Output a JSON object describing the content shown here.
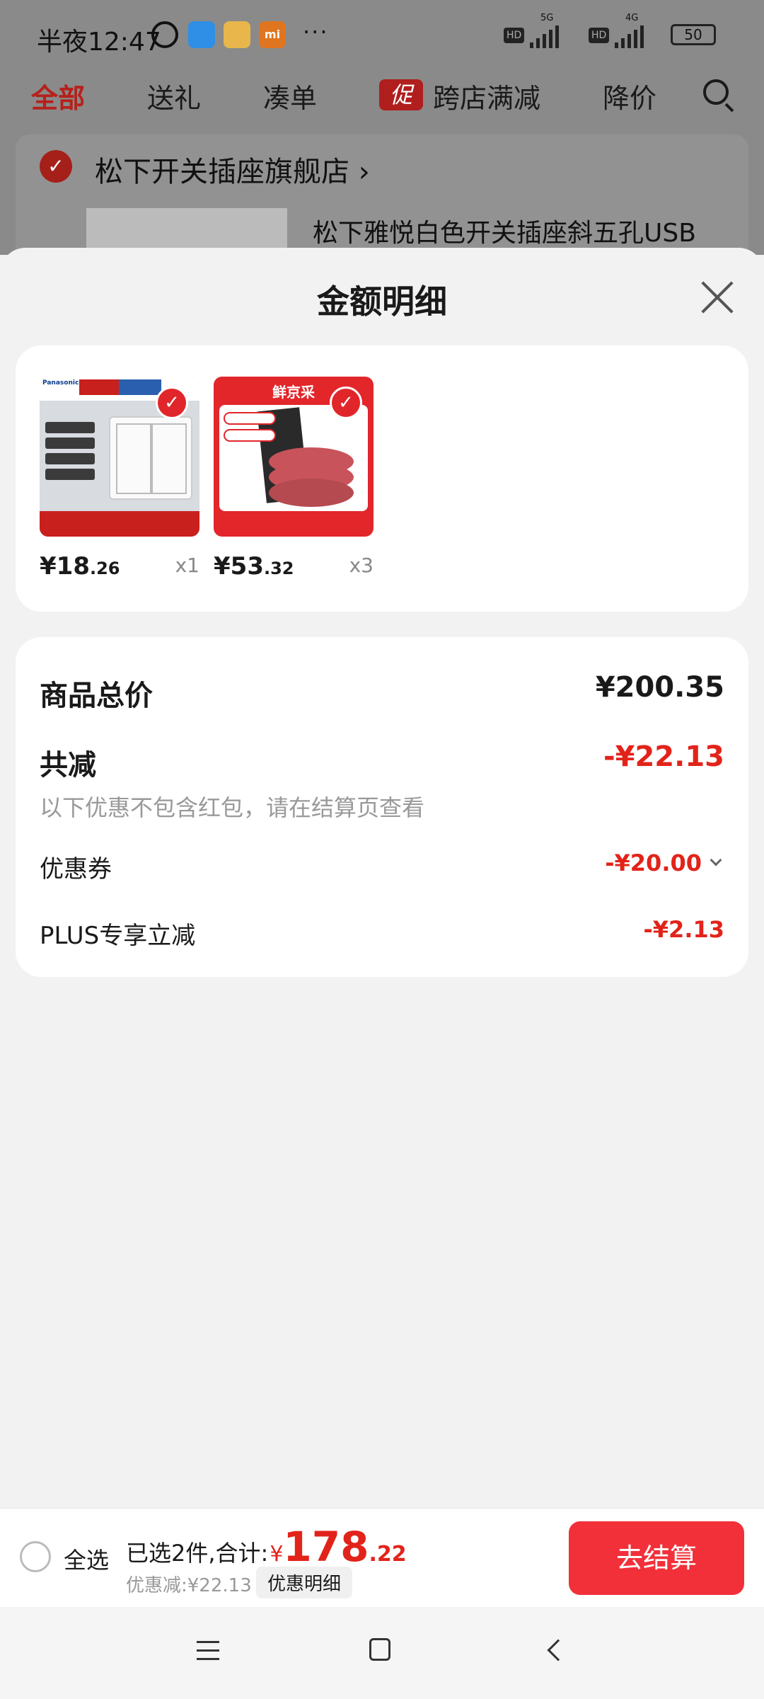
{
  "status_bar": {
    "time": "半夜12:47",
    "more": "···",
    "hd1": "HD",
    "net1": "5G",
    "hd2": "HD",
    "net2": "4G",
    "battery": "50"
  },
  "background": {
    "tabs": [
      "全部",
      "送礼",
      "凑单",
      "跨店满减",
      "降价"
    ],
    "promo_badge": "促",
    "store_name": "松下开关插座旗舰店",
    "store_chevron": "›",
    "product_title": "松下雅悦白色开关插座斜五孔USB"
  },
  "sheet": {
    "title": "金额明细",
    "products": [
      {
        "price_int": "¥18",
        "price_dec": ".26",
        "qty": "x1"
      },
      {
        "price_int": "¥53",
        "price_dec": ".32",
        "qty": "x3"
      }
    ],
    "image_labels": {
      "p1_brand": "Panasonic",
      "p2_top": "鲜京采"
    },
    "summary": {
      "total_label": "商品总价",
      "total_value": "¥200.35",
      "reduce_label": "共减",
      "reduce_value": "-¥22.13",
      "note": "以下优惠不包含红包，请在结算页查看",
      "coupon_label": "优惠券",
      "coupon_value": "-¥20.00",
      "plus_label": "PLUS专享立减",
      "plus_value": "-¥2.13"
    }
  },
  "checkout": {
    "select_all": "全选",
    "selected_label": "已选2件,合计:",
    "yen": "¥",
    "total_int": "178",
    "total_dec": ".22",
    "discount": "优惠减:¥22.13",
    "detail_button": "优惠明细",
    "checkout_button": "去结算"
  },
  "colors": {
    "accent_red": "#e2231a",
    "checkout_button": "#f2303a"
  }
}
